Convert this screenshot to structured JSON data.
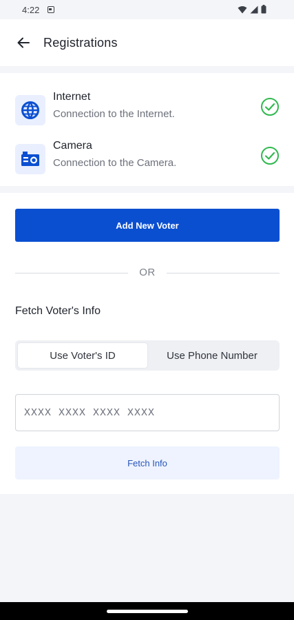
{
  "status_bar": {
    "time": "4:22"
  },
  "app_bar": {
    "title": "Registrations"
  },
  "checks": [
    {
      "title": "Internet",
      "description": "Connection to the Internet.",
      "icon": "globe-icon",
      "status": "ok"
    },
    {
      "title": "Camera",
      "description": "Connection to the Camera.",
      "icon": "camera-icon",
      "status": "ok"
    }
  ],
  "actions": {
    "add_voter_label": "Add New Voter",
    "or_label": "OR"
  },
  "fetch": {
    "section_title": "Fetch Voter's Info",
    "tabs": [
      {
        "label": "Use Voter's ID",
        "active": true
      },
      {
        "label": "Use Phone Number",
        "active": false
      }
    ],
    "id_placeholder": "XXXX XXXX XXXX XXXX",
    "fetch_button_label": "Fetch Info"
  },
  "colors": {
    "primary": "#0b4fd1",
    "success": "#2fb94e",
    "icon_bg": "#e9efff",
    "background": "#f4f5f8"
  }
}
